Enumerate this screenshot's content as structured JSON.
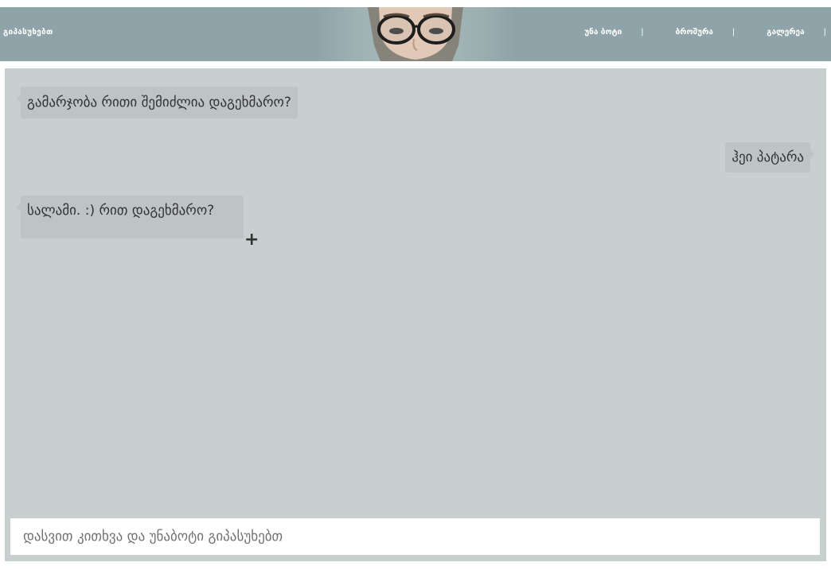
{
  "header": {
    "brand": "გიპასუხებთ",
    "nav": [
      {
        "label": "უნა ბოტი"
      },
      {
        "label": "ბროშურა"
      },
      {
        "label": "გალერეა"
      }
    ],
    "separator": "|"
  },
  "chat": {
    "messages": [
      {
        "side": "left",
        "text": "გამარჯობა რითი შემიძლია დაგეხმარო?"
      },
      {
        "side": "right",
        "text": "ჰეი პატარა"
      },
      {
        "side": "left",
        "text": "სალამი. :) რით დაგეხმარო?"
      }
    ],
    "cursor_symbol": "+"
  },
  "composer": {
    "placeholder": "დასვით კითხვა და უნაბოტი გიპასუხებთ"
  },
  "colors": {
    "header_bg": "#8fa4a8",
    "chat_bg": "#c8cfcf",
    "bubble_bg": "#bdc4c5",
    "text": "#333333"
  }
}
